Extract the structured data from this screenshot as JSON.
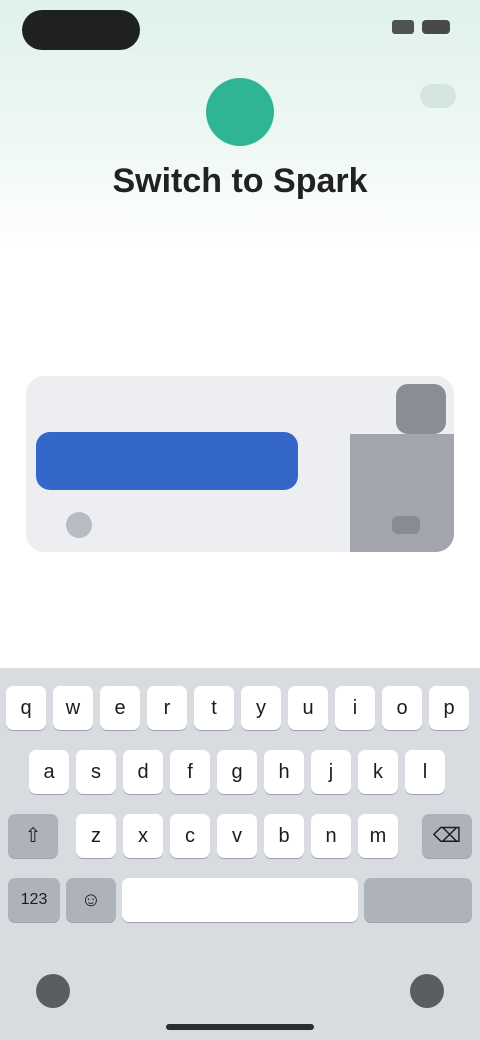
{
  "header": {
    "title": "Switch to Spark",
    "avatar_icon": "app-avatar",
    "accent": "#2fb594"
  },
  "content": {
    "row1_label": "",
    "row2_label": "",
    "card": {
      "label": "",
      "right_text": "",
      "primary_button": ""
    },
    "primary_color": "#3467c9"
  },
  "keyboard": {
    "row1": [
      "q",
      "w",
      "e",
      "r",
      "t",
      "y",
      "u",
      "i",
      "o",
      "p"
    ],
    "row2": [
      "a",
      "s",
      "d",
      "f",
      "g",
      "h",
      "j",
      "k",
      "l"
    ],
    "row3": [
      "z",
      "x",
      "c",
      "v",
      "b",
      "n",
      "m"
    ],
    "shift_icon": "shift-icon",
    "backspace_icon": "backspace-icon",
    "numbers_label": "123",
    "emoji_icon": "emoji-icon",
    "space_label": "",
    "return_label": "",
    "globe_icon": "globe-icon",
    "mic_icon": "mic-icon"
  }
}
